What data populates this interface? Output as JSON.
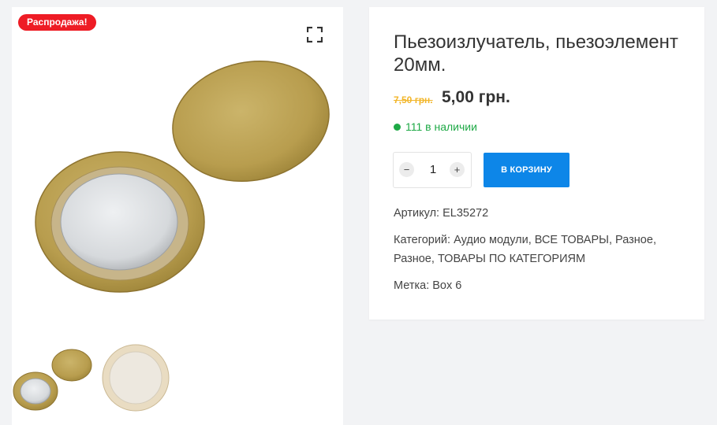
{
  "gallery": {
    "sale_badge": "Распродажа!",
    "expand_icon": "expand-icon"
  },
  "product": {
    "title": "Пьезоизлучатель, пьезоэлемент 20мм.",
    "old_price": "7,50 грн.",
    "new_price": "5,00 грн.",
    "stock": "111 в наличии",
    "quantity": "1",
    "qty_minus": "−",
    "qty_plus": "+",
    "add_to_cart": "В КОРЗИНУ",
    "sku_label": "Артикул:",
    "sku_value": "EL35272",
    "categories_label": "Категорий:",
    "categories": [
      "Аудио модули",
      "ВСЕ ТОВАРЫ",
      "Разное",
      "Разное",
      "ТОВАРЫ ПО КАТЕГОРИЯМ"
    ],
    "tag_label": "Метка:",
    "tag_value": "Box 6"
  },
  "colors": {
    "sale": "#ee1c25",
    "old_price": "#f2b62a",
    "stock": "#1ea946",
    "cart_button": "#0d86e8"
  }
}
